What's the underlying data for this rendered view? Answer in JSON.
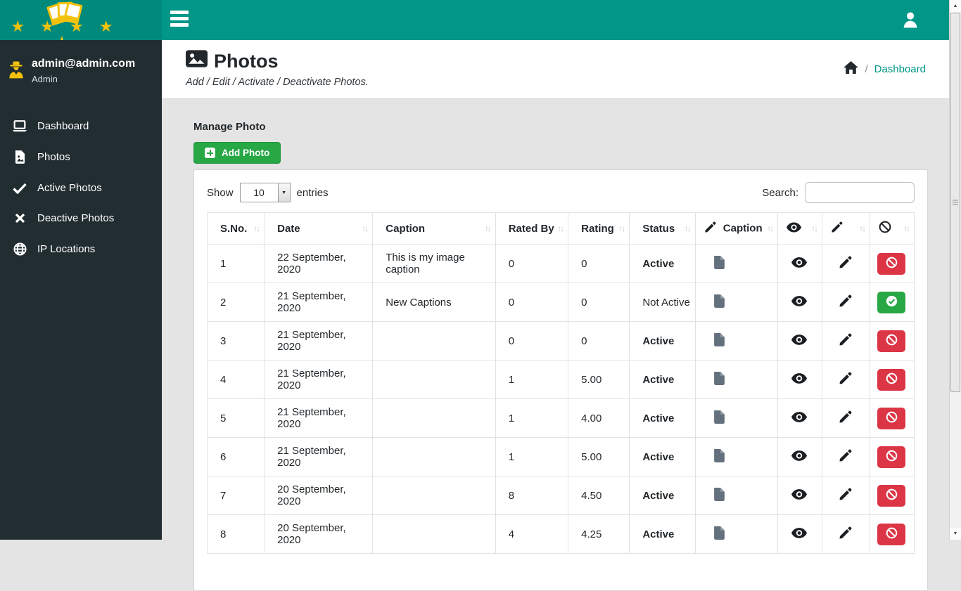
{
  "colors": {
    "navbar": "#009688",
    "logo-bg": "#008a7c",
    "sidebar-bg": "#222d32",
    "gold": "#f4c20d",
    "green": "#28a745",
    "red": "#dc3545",
    "content-bg": "#e4e4e4",
    "link": "#009688"
  },
  "sidebar": {
    "user": {
      "email": "admin@admin.com",
      "role": "Admin"
    },
    "items": [
      {
        "label": "Dashboard",
        "icon": "laptop-icon"
      },
      {
        "label": "Photos",
        "icon": "file-image-icon"
      },
      {
        "label": "Active Photos",
        "icon": "check-icon"
      },
      {
        "label": "Deactive Photos",
        "icon": "x-icon"
      },
      {
        "label": "IP Locations",
        "icon": "globe-icon"
      }
    ]
  },
  "page": {
    "title": "Photos",
    "subtitle": "Add / Edit / Activate / Deactivate Photos.",
    "breadcrumb": {
      "home_icon": "home-icon",
      "current": "Dashboard"
    }
  },
  "panel": {
    "heading": "Manage Photo",
    "add_button_label": "Add Photo",
    "show_label": "Show",
    "page_size": "10",
    "entries_label": "entries",
    "search_label": "Search:",
    "search_value": ""
  },
  "table": {
    "headers": {
      "sno": "S.No.",
      "date": "Date",
      "caption": "Caption",
      "rated_by": "Rated By",
      "rating": "Rating",
      "status": "Status",
      "caption_edit": "Caption"
    },
    "rows": [
      {
        "sno": "1",
        "date": "22 September, 2020",
        "caption": "This is my image caption",
        "rated_by": "0",
        "rating": "0",
        "status": "Active",
        "action": "deactivate"
      },
      {
        "sno": "2",
        "date": "21 September, 2020",
        "caption": "New Captions",
        "rated_by": "0",
        "rating": "0",
        "status": "Not Active",
        "action": "activate"
      },
      {
        "sno": "3",
        "date": "21 September, 2020",
        "caption": "",
        "rated_by": "0",
        "rating": "0",
        "status": "Active",
        "action": "deactivate"
      },
      {
        "sno": "4",
        "date": "21 September, 2020",
        "caption": "",
        "rated_by": "1",
        "rating": "5.00",
        "status": "Active",
        "action": "deactivate"
      },
      {
        "sno": "5",
        "date": "21 September, 2020",
        "caption": "",
        "rated_by": "1",
        "rating": "4.00",
        "status": "Active",
        "action": "deactivate"
      },
      {
        "sno": "6",
        "date": "21 September, 2020",
        "caption": "",
        "rated_by": "1",
        "rating": "5.00",
        "status": "Active",
        "action": "deactivate"
      },
      {
        "sno": "7",
        "date": "20 September, 2020",
        "caption": "",
        "rated_by": "8",
        "rating": "4.50",
        "status": "Active",
        "action": "deactivate"
      },
      {
        "sno": "8",
        "date": "20 September, 2020",
        "caption": "",
        "rated_by": "4",
        "rating": "4.25",
        "status": "Active",
        "action": "deactivate"
      }
    ]
  }
}
